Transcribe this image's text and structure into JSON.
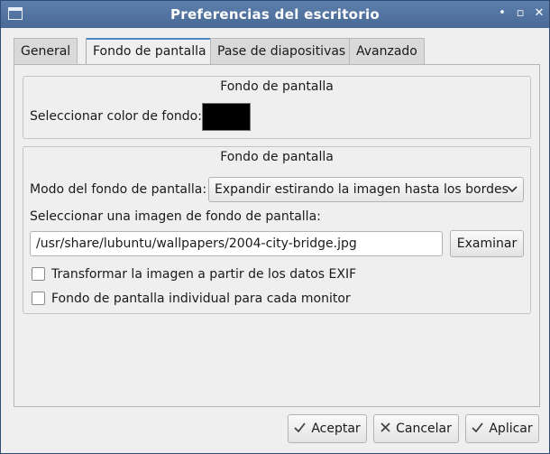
{
  "window": {
    "title": "Preferencias del escritorio",
    "controls": {
      "minimize": "•",
      "maximize": "▫",
      "close": "✕"
    }
  },
  "tabs": [
    {
      "label": "General"
    },
    {
      "label": "Fondo de pantalla",
      "active": true
    },
    {
      "label": "Pase de diapositivas"
    },
    {
      "label": "Avanzado"
    }
  ],
  "group1": {
    "title": "Fondo de pantalla",
    "color_label": "Seleccionar color de fondo:",
    "color_value": "#000000"
  },
  "group2": {
    "title": "Fondo de pantalla",
    "mode_label": "Modo del fondo de pantalla:",
    "mode_value": "Expandir estirando la imagen hasta los bordes",
    "image_label": "Seleccionar una imagen de fondo de pantalla:",
    "image_path": "/usr/share/lubuntu/wallpapers/2004-city-bridge.jpg",
    "browse_label": "Examinar",
    "exif_label": "Transformar la imagen a partir de los datos EXIF",
    "exif_checked": false,
    "per_monitor_label": "Fondo de pantalla individual para cada monitor",
    "per_monitor_checked": false
  },
  "footer": {
    "accept_label": "Aceptar",
    "cancel_label": "Cancelar",
    "apply_label": "Aplicar"
  },
  "colors": {
    "titlebar": "#4e6d96",
    "accent": "#4f86c6",
    "window_bg": "#efefef"
  }
}
